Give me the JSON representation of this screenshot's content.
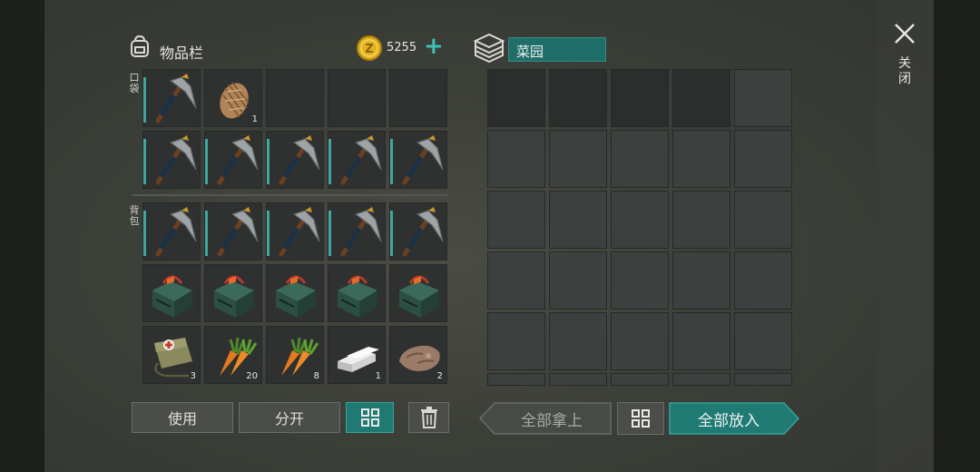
{
  "inventory": {
    "title": "物品栏",
    "pocket_label": "口袋",
    "backpack_label": "背包",
    "currency": {
      "value": "5255",
      "add": "+"
    },
    "slots": [
      {
        "row": 0,
        "col": 0,
        "item": "pickaxe",
        "count": "",
        "selected": true
      },
      {
        "row": 0,
        "col": 1,
        "item": "hay",
        "count": "1",
        "selected": false
      },
      {
        "row": 0,
        "col": 2,
        "item": "",
        "count": "",
        "selected": false
      },
      {
        "row": 0,
        "col": 3,
        "item": "",
        "count": "",
        "selected": false
      },
      {
        "row": 0,
        "col": 4,
        "item": "",
        "count": "",
        "selected": false
      },
      {
        "row": 1,
        "col": 0,
        "item": "pickaxe",
        "count": "",
        "selected": true
      },
      {
        "row": 1,
        "col": 1,
        "item": "pickaxe",
        "count": "",
        "selected": true
      },
      {
        "row": 1,
        "col": 2,
        "item": "pickaxe",
        "count": "",
        "selected": true
      },
      {
        "row": 1,
        "col": 3,
        "item": "pickaxe",
        "count": "",
        "selected": true
      },
      {
        "row": 1,
        "col": 4,
        "item": "pickaxe",
        "count": "",
        "selected": true
      },
      {
        "row": 2,
        "col": 0,
        "item": "pickaxe",
        "count": "",
        "selected": true
      },
      {
        "row": 2,
        "col": 1,
        "item": "pickaxe",
        "count": "",
        "selected": true
      },
      {
        "row": 2,
        "col": 2,
        "item": "pickaxe",
        "count": "",
        "selected": true
      },
      {
        "row": 2,
        "col": 3,
        "item": "pickaxe",
        "count": "",
        "selected": true
      },
      {
        "row": 2,
        "col": 4,
        "item": "pickaxe",
        "count": "",
        "selected": true
      },
      {
        "row": 3,
        "col": 0,
        "item": "toolkit",
        "count": "",
        "selected": false
      },
      {
        "row": 3,
        "col": 1,
        "item": "toolkit",
        "count": "",
        "selected": false
      },
      {
        "row": 3,
        "col": 2,
        "item": "toolkit",
        "count": "",
        "selected": false
      },
      {
        "row": 3,
        "col": 3,
        "item": "toolkit",
        "count": "",
        "selected": false
      },
      {
        "row": 3,
        "col": 4,
        "item": "toolkit",
        "count": "",
        "selected": false
      },
      {
        "row": 4,
        "col": 0,
        "item": "medbag",
        "count": "3",
        "selected": false
      },
      {
        "row": 4,
        "col": 1,
        "item": "carrot",
        "count": "20",
        "selected": false
      },
      {
        "row": 4,
        "col": 2,
        "item": "carrot",
        "count": "8",
        "selected": false
      },
      {
        "row": 4,
        "col": 3,
        "item": "iron-bar",
        "count": "1",
        "selected": false
      },
      {
        "row": 4,
        "col": 4,
        "item": "stone",
        "count": "2",
        "selected": false
      }
    ],
    "use_label": "使用",
    "split_label": "分开"
  },
  "container": {
    "name": "菜园",
    "take_all_label": "全部拿上",
    "put_all_label": "全部放入"
  },
  "close_label": "关闭",
  "colors": {
    "accent": "#1f7a74",
    "accent_light": "#3ea8a0",
    "coin": "#e3b21e"
  }
}
